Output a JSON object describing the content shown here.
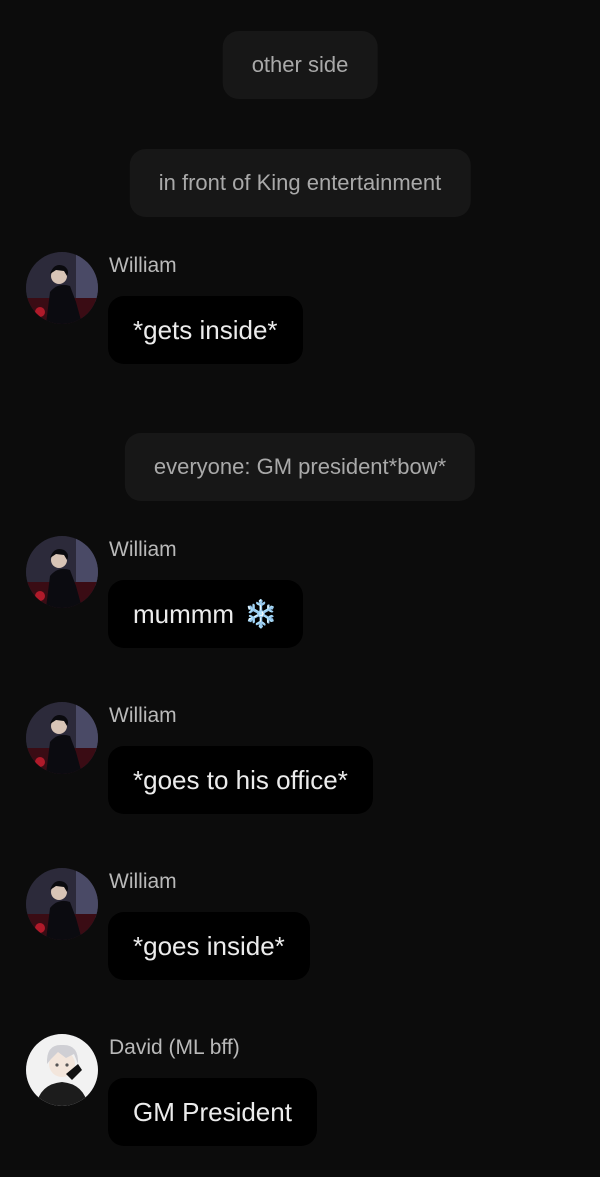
{
  "system_messages": [
    "other side",
    "in front of King entertainment",
    "everyone: GM president*bow*"
  ],
  "messages": [
    {
      "sender": "William",
      "avatar": "william-avatar",
      "text": "*gets inside*"
    },
    {
      "sender": "William",
      "avatar": "william-avatar",
      "text": "mummm",
      "emoji": "❄️"
    },
    {
      "sender": "William",
      "avatar": "william-avatar",
      "text": "*goes to his office*"
    },
    {
      "sender": "William",
      "avatar": "william-avatar",
      "text": "*goes inside*"
    },
    {
      "sender": "David (ML bff)",
      "avatar": "david-avatar",
      "text": "GM President"
    }
  ],
  "colors": {
    "background": "#0c0c0c",
    "system_bubble": "#171717",
    "message_bubble": "#000000",
    "sender_name": "#b9b9b9"
  }
}
